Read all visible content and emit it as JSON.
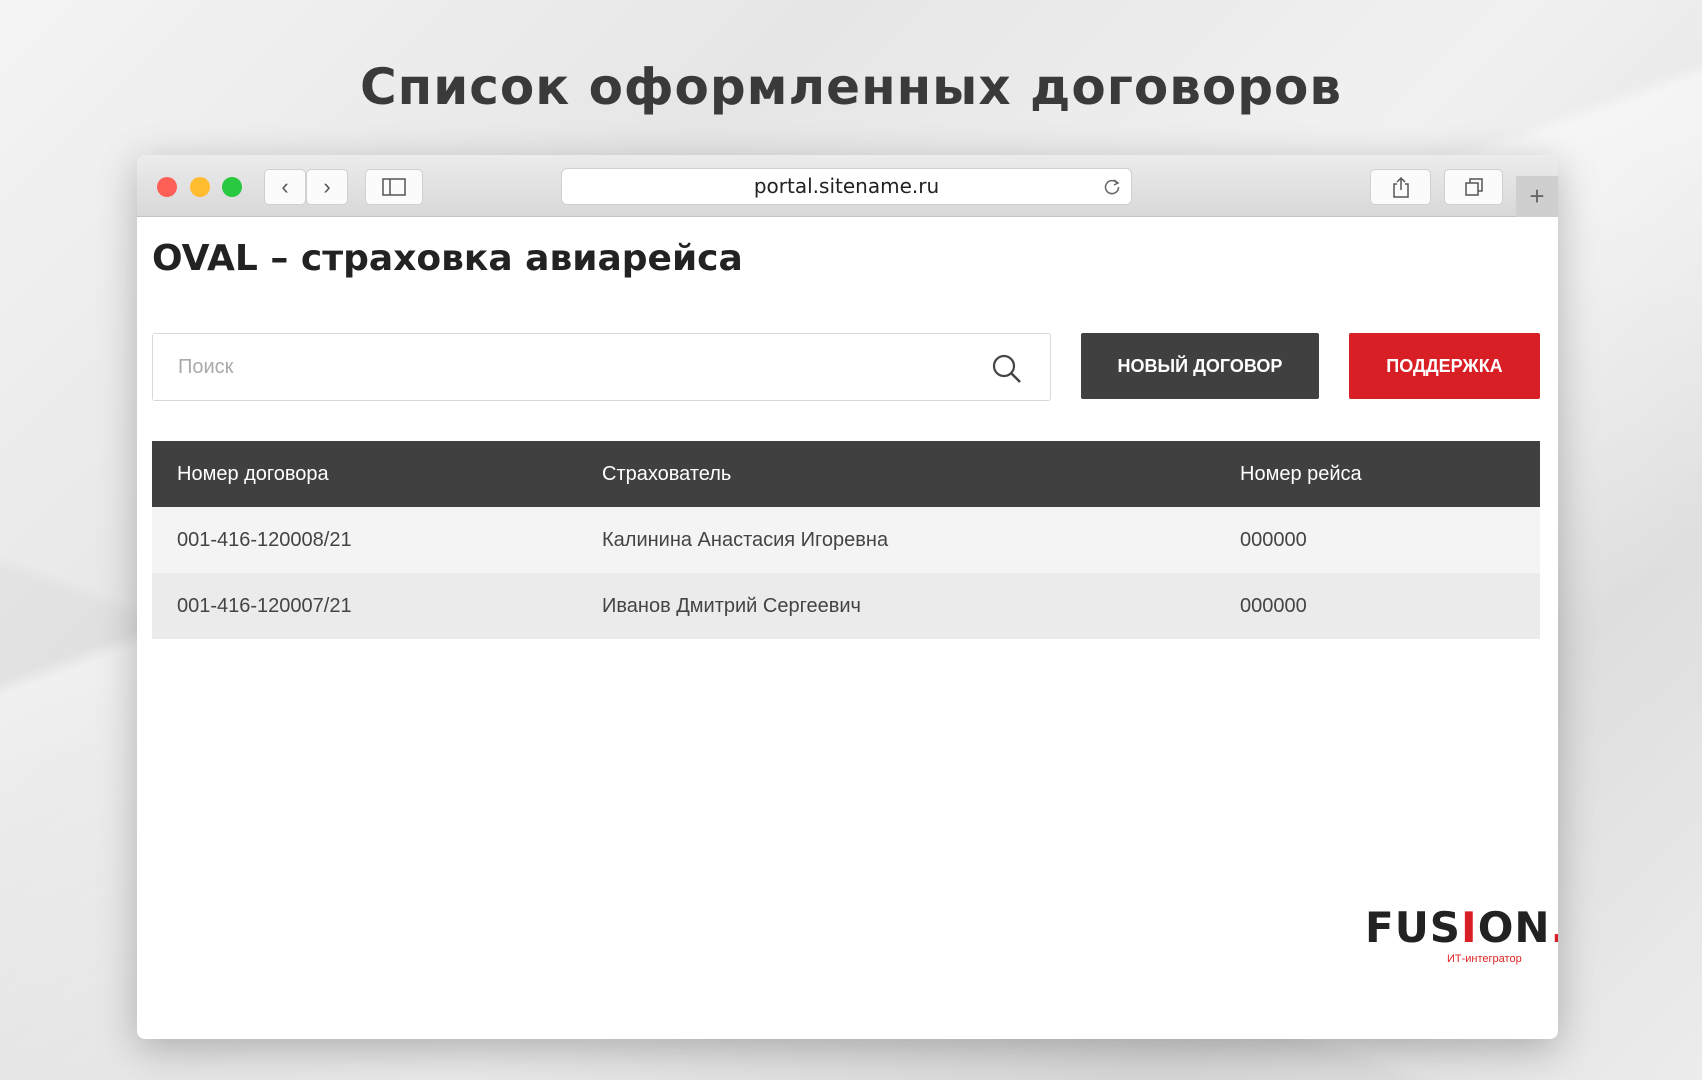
{
  "headline": "Список оформленных договоров",
  "browser": {
    "url": "portal.sitename.ru"
  },
  "app": {
    "title": "OVAL – страховка авиарейса",
    "search_placeholder": "Поиск",
    "new_button": "НОВЫЙ ДОГОВОР",
    "support_button": "ПОДДЕРЖКА"
  },
  "table": {
    "headers": [
      "Номер договора",
      "Страхователь",
      "Номер рейса"
    ],
    "rows": [
      [
        "001-416-120008/21",
        "Калинина Анастасия Игоревна",
        "000000"
      ],
      [
        "001-416-120007/21",
        "Иванов Дмитрий Сергеевич",
        "000000"
      ]
    ]
  },
  "logo": {
    "name": "FUSION.",
    "tagline": "ИТ-интегратор"
  },
  "colors": {
    "accent": "#d91f26",
    "dark": "#404040"
  }
}
